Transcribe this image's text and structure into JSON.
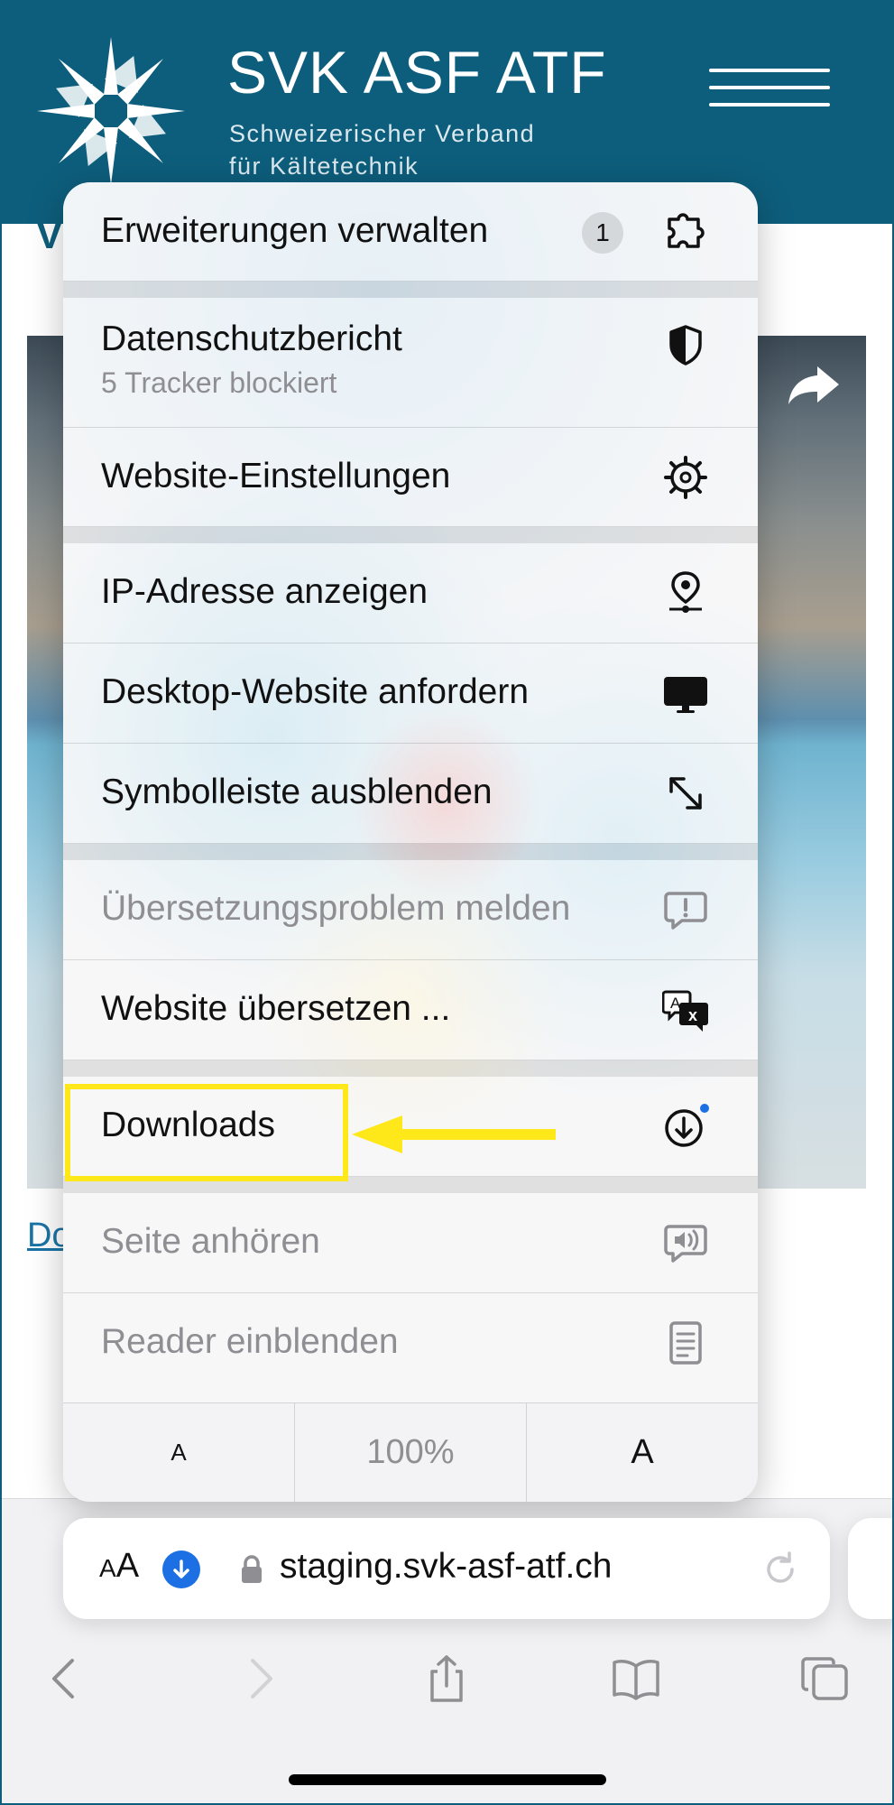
{
  "site": {
    "title": "SVK ASF ATF",
    "subtitle_line1": "Schweizerischer Verband",
    "subtitle_line2": "für Kältetechnik",
    "bg_heading_partial": "V",
    "bg_link_partial": "Do"
  },
  "menu": {
    "items": [
      {
        "label": "Erweiterungen verwalten",
        "badge": "1",
        "icon": "extension-icon"
      },
      {
        "label": "Datenschutzbericht",
        "sublabel": "5 Tracker blockiert",
        "icon": "privacy-shield-icon"
      },
      {
        "label": "Website-Einstellungen",
        "icon": "gear-icon"
      },
      {
        "label": "IP-Adresse anzeigen",
        "icon": "location-pin-icon"
      },
      {
        "label": "Desktop-Website anfordern",
        "icon": "desktop-icon"
      },
      {
        "label": "Symbolleiste ausblenden",
        "icon": "expand-arrows-icon"
      },
      {
        "label": "Übersetzungsproblem melden",
        "icon": "report-bubble-icon",
        "disabled": true
      },
      {
        "label": "Website übersetzen ...",
        "icon": "translate-icon"
      },
      {
        "label": "Downloads",
        "icon": "download-icon",
        "has_dot": true
      },
      {
        "label": "Seite anhören",
        "icon": "speaker-bubble-icon",
        "disabled": true
      },
      {
        "label": "Reader einblenden",
        "icon": "reader-icon",
        "disabled": true
      }
    ],
    "font_size": {
      "smaller": "A",
      "zoom": "100%",
      "larger": "A"
    }
  },
  "address_bar": {
    "aa_small": "A",
    "aa_large": "A",
    "url": "staging.svk-asf-atf.ch"
  },
  "toolbar": {
    "buttons": [
      "back-icon",
      "forward-icon",
      "share-icon",
      "bookmarks-icon",
      "tabs-icon"
    ]
  },
  "colors": {
    "header_bg": "#0d5e7c",
    "highlight": "#ffe81a",
    "accent_blue": "#1d70e3",
    "disabled_text": "#8e8e93"
  }
}
